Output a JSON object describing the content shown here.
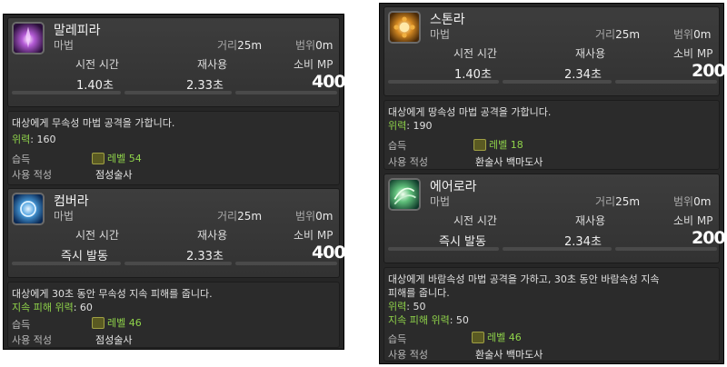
{
  "panels": [
    {
      "skills": [
        {
          "name": "말레피라",
          "type": "마법",
          "range_label": "거리",
          "range_value": "25m",
          "radius_label": "범위",
          "radius_value": "0m",
          "cast_label": "시전 시간",
          "cast_value": "1.40초",
          "recast_label": "재사용",
          "recast_value": "2.33초",
          "cost_label": "소비 MP",
          "cost_value": "400",
          "description": [
            "대상에게 무속성 마법 공격을 가합니다."
          ],
          "stats": [
            {
              "label": "위력",
              "value": ": 160"
            }
          ],
          "acquired_label": "습득",
          "level_text": "레벨 54",
          "affinity_label": "사용 적성",
          "affinity_value": "점성술사",
          "icon": "malefic-icon"
        },
        {
          "name": "컴버라",
          "type": "마법",
          "range_label": "거리",
          "range_value": "25m",
          "radius_label": "범위",
          "radius_value": "0m",
          "cast_label": "시전 시간",
          "cast_value": "즉시 발동",
          "recast_label": "재사용",
          "recast_value": "2.33초",
          "cost_label": "소비 MP",
          "cost_value": "400",
          "description": [
            "대상에게 30초 동안 무속성 지속 피해를 줍니다."
          ],
          "stats": [
            {
              "label": "지속 피해 위력",
              "value": ": 60"
            }
          ],
          "acquired_label": "습득",
          "level_text": "레벨 46",
          "affinity_label": "사용 적성",
          "affinity_value": "점성술사",
          "icon": "combust-icon"
        }
      ]
    },
    {
      "skills": [
        {
          "name": "스톤라",
          "type": "마법",
          "range_label": "거리",
          "range_value": "25m",
          "radius_label": "범위",
          "radius_value": "0m",
          "cast_label": "시전 시간",
          "cast_value": "1.40초",
          "recast_label": "재사용",
          "recast_value": "2.34초",
          "cost_label": "소비 MP",
          "cost_value": "200",
          "description": [
            "대상에게 땅속성 마법 공격을 가합니다."
          ],
          "stats": [
            {
              "label": "위력",
              "value": ": 190"
            }
          ],
          "acquired_label": "습득",
          "level_text": "레벨 18",
          "affinity_label": "사용 적성",
          "affinity_value": "환술사 백마도사",
          "icon": "stone-icon"
        },
        {
          "name": "에어로라",
          "type": "마법",
          "range_label": "거리",
          "range_value": "25m",
          "radius_label": "범위",
          "radius_value": "0m",
          "cast_label": "시전 시간",
          "cast_value": "즉시 발동",
          "recast_label": "재사용",
          "recast_value": "2.34초",
          "cost_label": "소비 MP",
          "cost_value": "200",
          "description": [
            "대상에게 바람속성 마법 공격을 가하고, 30초 동안 바람속성 지속",
            "피해를 줍니다."
          ],
          "stats": [
            {
              "label": "위력",
              "value": ": 50"
            },
            {
              "label": "지속 피해 위력",
              "value": ": 50"
            }
          ],
          "acquired_label": "습득",
          "level_text": "레벨 46",
          "affinity_label": "사용 적성",
          "affinity_value": "환술사 백마도사",
          "icon": "aero-icon"
        }
      ]
    }
  ]
}
